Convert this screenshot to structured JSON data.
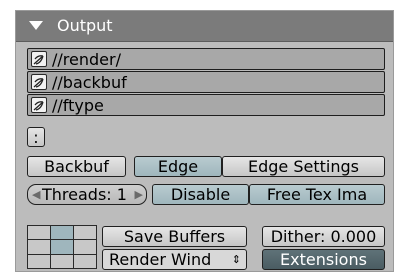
{
  "panel": {
    "title": "Output",
    "paths": [
      {
        "value": "//render/"
      },
      {
        "value": "//backbuf"
      },
      {
        "value": "//ftype"
      }
    ],
    "small_button_label": ":",
    "row1": {
      "backbuf_label": "Backbuf",
      "edge_label": "Edge",
      "edge_settings_label": "Edge Settings"
    },
    "row2": {
      "threads_label": "Threads: 1",
      "disable_label": "Disable",
      "free_tex_label": "Free Tex Ima"
    },
    "row3": {
      "save_buffers_label": "Save Buffers",
      "dither_label": "Dither: 0.000",
      "render_window_label": "Render Wind",
      "extensions_label": "Extensions"
    }
  },
  "colors": {
    "header": "#7b7b7b",
    "panel": "#bcbcbc",
    "toggle_on": "#9fb6bd",
    "dark_button": "#4a5c62"
  }
}
